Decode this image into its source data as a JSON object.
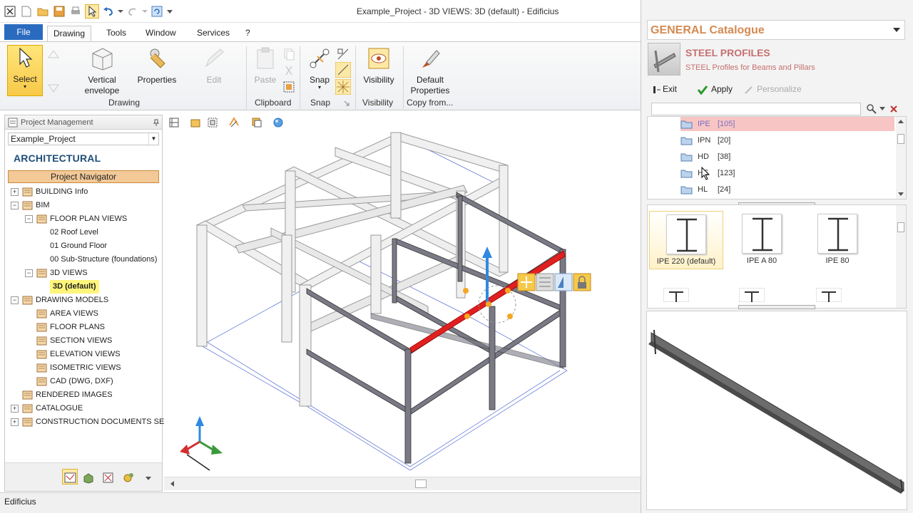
{
  "window": {
    "title": "Example_Project - 3D VIEWS: 3D (default) - Edificius"
  },
  "menu": {
    "file": "File",
    "tabs": [
      {
        "label": "Drawing",
        "active": true
      },
      {
        "label": "Tools"
      },
      {
        "label": "Window"
      },
      {
        "label": "Services"
      },
      {
        "label": "?"
      }
    ]
  },
  "ribbon": {
    "select": "Select",
    "vertical_envelope": "Vertical\nenvelope",
    "vertical_envelope_l1": "Vertical",
    "vertical_envelope_l2": "envelope",
    "properties": "Properties",
    "edit": "Edit",
    "drawing_group": "Drawing",
    "paste": "Paste",
    "clipboard_group": "Clipboard",
    "snap": "Snap",
    "snap_group": "Snap",
    "visibility": "Visibility",
    "visibility_group": "Visibility",
    "default_properties_l1": "Default",
    "default_properties_l2": "Properties",
    "copy_from_group": "Copy from..."
  },
  "left_panel": {
    "header": "Project Management",
    "project": "Example_Project",
    "title": "ARCHITECTURAL",
    "navigator": "Project Navigator",
    "tree": [
      {
        "label": "BUILDING Info",
        "level": 0,
        "expander": "+"
      },
      {
        "label": "BIM",
        "level": 0,
        "expander": "−"
      },
      {
        "label": "FLOOR PLAN VIEWS",
        "level": 1,
        "expander": "−"
      },
      {
        "label": "02 Roof Level",
        "level": 2
      },
      {
        "label": "01 Ground Floor",
        "level": 2
      },
      {
        "label": "00 Sub-Structure (foundations)",
        "level": 2
      },
      {
        "label": "3D VIEWS",
        "level": 1,
        "expander": "−"
      },
      {
        "label": "3D (default)",
        "level": 2,
        "selected": true
      },
      {
        "label": "DRAWING MODELS",
        "level": 0,
        "expander": "−"
      },
      {
        "label": "AREA VIEWS",
        "level": 1
      },
      {
        "label": "FLOOR PLANS",
        "level": 1
      },
      {
        "label": "SECTION VIEWS",
        "level": 1
      },
      {
        "label": "ELEVATION VIEWS",
        "level": 1
      },
      {
        "label": "ISOMETRIC VIEWS",
        "level": 1
      },
      {
        "label": "CAD (DWG, DXF)",
        "level": 1
      },
      {
        "label": "RENDERED IMAGES",
        "level": 0
      },
      {
        "label": "CATALOGUE",
        "level": 0,
        "expander": "+"
      },
      {
        "label": "CONSTRUCTION DOCUMENTS SET",
        "level": 0,
        "expander": "+"
      }
    ]
  },
  "status": {
    "text": "Edificius"
  },
  "catalogue": {
    "title": "GENERAL Catalogue",
    "section_title": "STEEL PROFILES",
    "section_sub": "STEEL Profiles for Beams and Pillars",
    "exit": "Exit",
    "apply": "Apply",
    "personalize": "Personalize",
    "types": [
      {
        "name": "IPE",
        "count": "[105]",
        "selected": true
      },
      {
        "name": "IPN",
        "count": "[20]"
      },
      {
        "name": "HD",
        "count": "[38]"
      },
      {
        "name": "HE",
        "count": "[123]"
      },
      {
        "name": "HL",
        "count": "[24]"
      }
    ],
    "profiles": [
      {
        "label": "IPE 220 (default)",
        "selected": true
      },
      {
        "label": "IPE A 80"
      },
      {
        "label": "IPE 80"
      }
    ]
  },
  "colors": {
    "accent": "#2a6bbf",
    "catalogue_title": "#d48a52",
    "steel_title": "#c66f70",
    "selected_beam": "#e02020",
    "tree_selected": "#fff57a"
  }
}
